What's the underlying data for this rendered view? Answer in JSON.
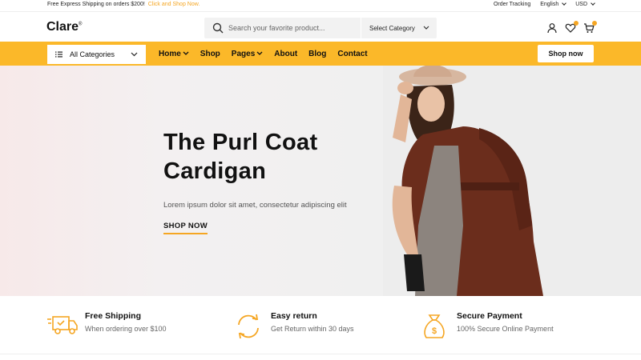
{
  "topbar": {
    "promo_text": "Free Express Shipping on orders $200!",
    "promo_link": "Click and Shop Now.",
    "order_tracking": "Order Tracking",
    "language": "English",
    "currency": "USD"
  },
  "header": {
    "logo": "Clare",
    "logo_mark": "®",
    "search_placeholder": "Search your favorite product...",
    "category_select": "Select Category",
    "icons": [
      "user-icon",
      "heart-icon",
      "cart-icon"
    ]
  },
  "nav": {
    "all_categories": "All Categories",
    "links": [
      {
        "label": "Home",
        "dropdown": true
      },
      {
        "label": "Shop",
        "dropdown": false
      },
      {
        "label": "Pages",
        "dropdown": true
      },
      {
        "label": "About",
        "dropdown": false
      },
      {
        "label": "Blog",
        "dropdown": false
      },
      {
        "label": "Contact",
        "dropdown": false
      }
    ],
    "cta": "Shop now"
  },
  "hero": {
    "title_line1": "The Purl Coat",
    "title_line2": "Cardigan",
    "subtitle": "Lorem ipsum dolor sit amet, consectetur adipiscing elit",
    "cta": "SHOP NOW"
  },
  "features": [
    {
      "icon": "truck-icon",
      "title": "Free Shipping",
      "desc": "When ordering over $100"
    },
    {
      "icon": "refresh-icon",
      "title": "Easy return",
      "desc": "Get Return within 30 days"
    },
    {
      "icon": "money-bag-icon",
      "title": "Secure Payment",
      "desc": "100% Secure Online Payment"
    }
  ],
  "colors": {
    "accent": "#fbb829",
    "accent_text": "#f5a623"
  }
}
